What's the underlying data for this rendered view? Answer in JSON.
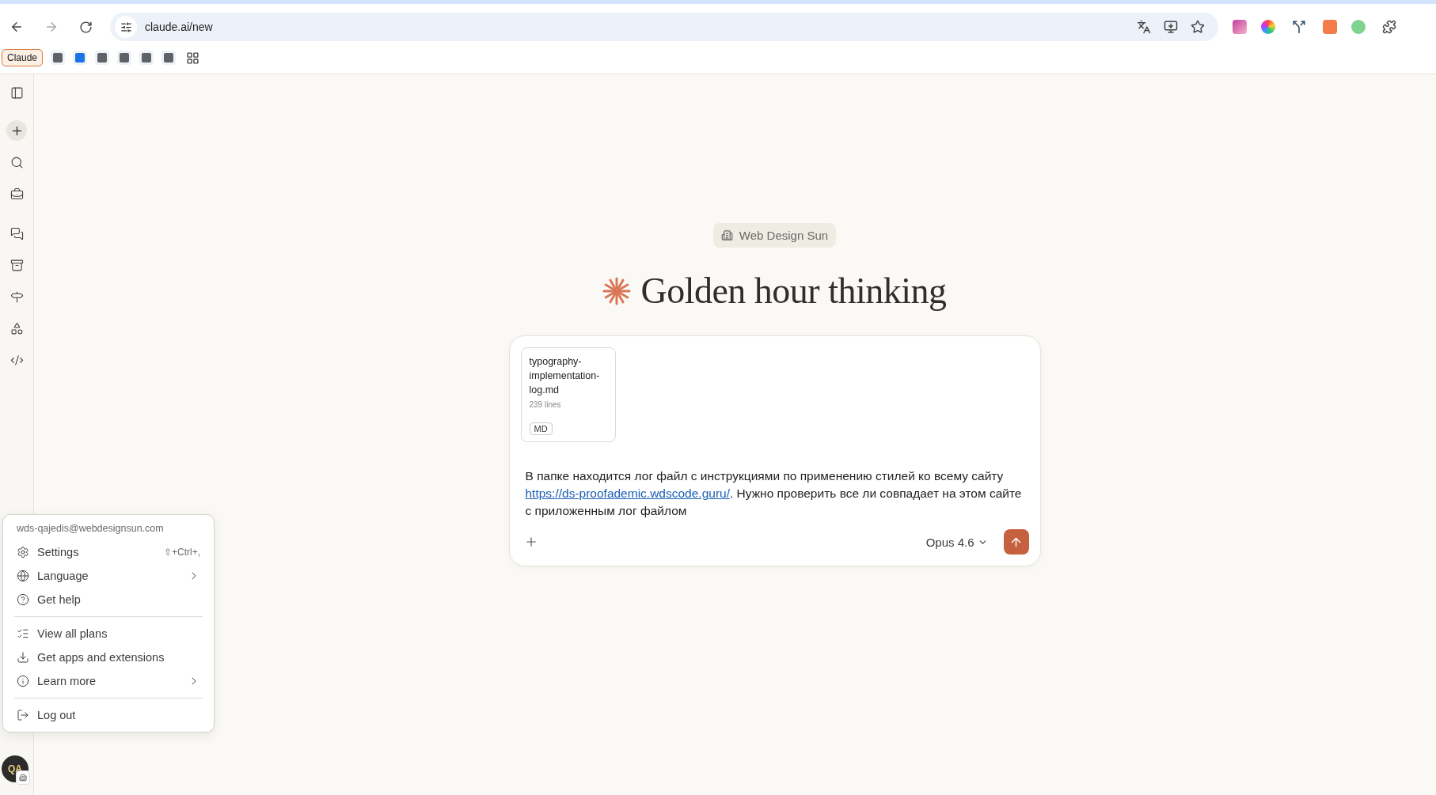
{
  "browser": {
    "url": "claude.ai/new",
    "bookmarks": {
      "label": "Claude",
      "items": [
        {
          "color": "#5f6368"
        },
        {
          "color": "#1a73e8"
        },
        {
          "color": "#5f6368"
        },
        {
          "color": "#5f6368"
        },
        {
          "color": "#5f6368"
        },
        {
          "color": "#5f6368"
        }
      ]
    }
  },
  "organization": {
    "label": "Web Design Sun"
  },
  "greeting": "Golden hour thinking",
  "composer": {
    "attachment": {
      "name": "typography-implementation-log.md",
      "lines": "239 lines",
      "type": "MD"
    },
    "message": {
      "text_before": "В папке находится лог файл с инструкциями по применению стилей ко всему сайту ",
      "link": "https://ds-proofademic.wdscode.guru/",
      "text_after": ". Нужно проверить все ли совпадает на этом сайте с приложенным лог файлом"
    },
    "model": "Opus 4.6"
  },
  "account_menu": {
    "email": "wds-qajedis@webdesignsun.com",
    "groups": [
      [
        {
          "label": "Settings",
          "shortcut": "⇧+Ctrl+,",
          "submenu": false
        },
        {
          "label": "Language",
          "submenu": true
        },
        {
          "label": "Get help",
          "submenu": false
        }
      ],
      [
        {
          "label": "View all plans",
          "submenu": false
        },
        {
          "label": "Get apps and extensions",
          "submenu": false
        },
        {
          "label": "Learn more",
          "submenu": true
        }
      ],
      [
        {
          "label": "Log out",
          "submenu": false
        }
      ]
    ]
  },
  "avatar": {
    "initials": "QA"
  }
}
